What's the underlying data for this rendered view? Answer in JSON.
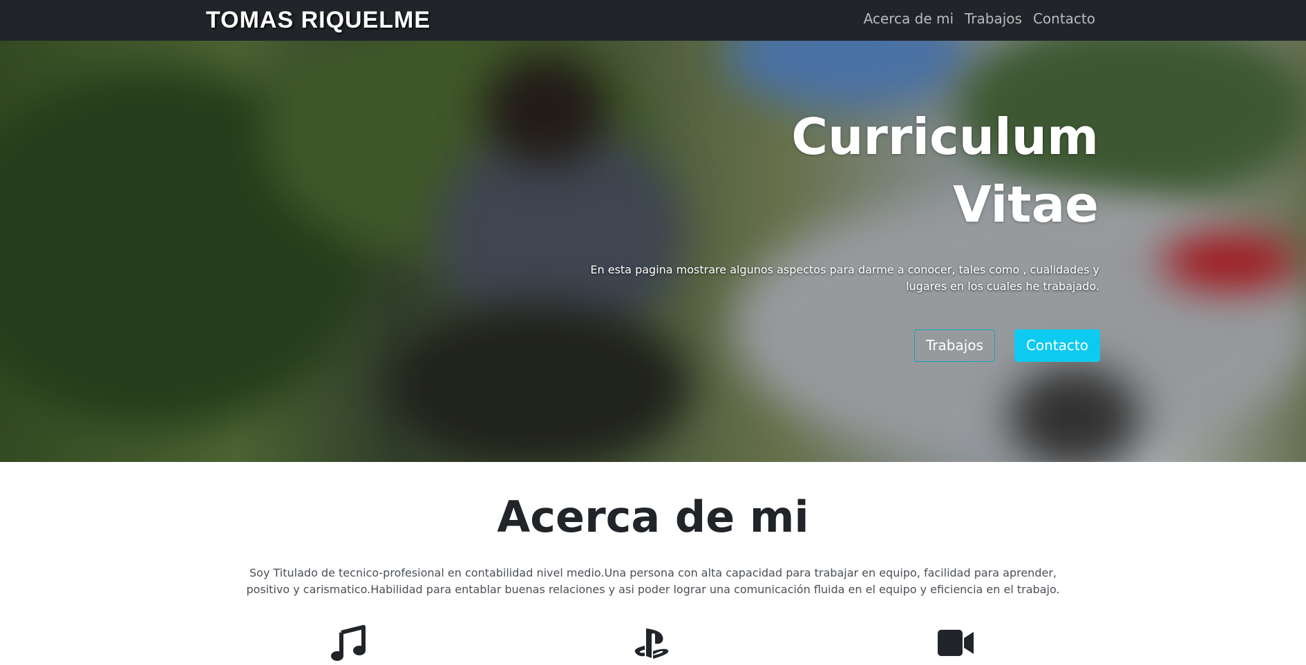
{
  "navbar": {
    "brand": "TOMAS RIQUELME",
    "links": [
      "Acerca de mi",
      "Trabajos",
      "Contacto"
    ]
  },
  "hero": {
    "title_line1": "Curriculum",
    "title_line2": "Vitae",
    "text": "En esta pagina mostrare algunos aspectos para darme a conocer, tales como , cualidades y lugares en los cuales he trabajado.",
    "button_primary": "Trabajos",
    "button_secondary": "Contacto"
  },
  "about": {
    "title": "Acerca de mi",
    "text": "Soy Titulado de tecnico-profesional en contabilidad nivel medio.Una persona con alta capacidad para trabajar en equipo, facilidad para aprender, positivo y carismatico.Habilidad para entablar buenas relaciones y asi poder lograr una comunicación fluida en el equipo y eficiencia en el trabajo."
  },
  "features": {
    "icons": [
      "music-icon",
      "playstation-icon",
      "video-camera-icon"
    ]
  },
  "colors": {
    "navbar": "#212529",
    "accent": "#0dcaf0",
    "outline": "#17a2b8"
  }
}
